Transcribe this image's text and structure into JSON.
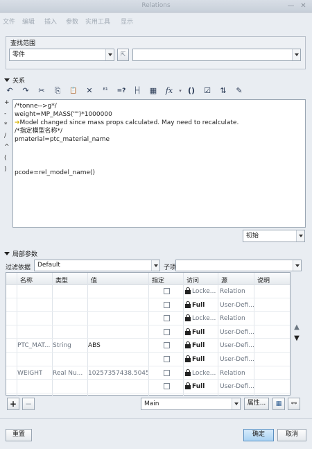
{
  "window": {
    "title": "Relations"
  },
  "menu": [
    "文件",
    "编辑",
    "插入",
    "参数",
    "实用工具",
    "显示"
  ],
  "lookup": {
    "header": "查找范围",
    "scope_value": "零件",
    "object_value": ""
  },
  "relations": {
    "header": "关系",
    "toolbar_icons": [
      "undo-icon",
      "redo-icon",
      "cut-icon",
      "copy-icon",
      "paste-icon",
      "delete-icon",
      "evaluate-icon",
      "equals-icon",
      "measure-icon",
      "units-icon",
      "function-icon",
      "parentheses-icon",
      "verify-icon",
      "sort-icon",
      "insert-icon"
    ],
    "toolbar_glyphs": [
      "↶",
      "↷",
      "✂",
      "⎘",
      "📋",
      "✕",
      "⁸¹",
      "=?",
      "├┤",
      "▦",
      "fx",
      "()",
      "☑",
      "⇅",
      "✎"
    ],
    "side_symbols": [
      "+",
      "-",
      "*",
      "/",
      "^",
      "(",
      ")"
    ],
    "lines": [
      "/*tonne-->g*/",
      "weight=MP_MASS(\"\")*1000000",
      "Model changed since mass props calculated. May need to recalculate.",
      "/*指定模型名称*/",
      "pmaterial=ptc_material_name",
      "",
      "",
      "",
      "pcode=rel_model_name()"
    ],
    "init_select": "初始"
  },
  "local_params": {
    "header": "局部参数",
    "filter_label": "过滤依据",
    "filter_value": "Default",
    "subitem_label": "子项",
    "subitem_value": "",
    "columns": [
      "名称",
      "类型",
      "值",
      "指定",
      "访问",
      "源",
      "说明"
    ],
    "rows": [
      {
        "name": "",
        "type": "",
        "value": "",
        "access": "Locke...",
        "source": "Relation"
      },
      {
        "name": "",
        "type": "",
        "value": "",
        "access": "Full",
        "source": "User-Defi..."
      },
      {
        "name": "",
        "type": "",
        "value": "",
        "access": "Locke...",
        "source": "Relation"
      },
      {
        "name": "",
        "type": "",
        "value": "",
        "access": "Full",
        "source": "User-Defi..."
      },
      {
        "name": "PTC_MAT...",
        "type": "String",
        "value": "ABS",
        "access": "Full",
        "source": "User-Defi..."
      },
      {
        "name": "",
        "type": "",
        "value": "",
        "access": "Full",
        "source": "User-Defi..."
      },
      {
        "name": "WEIGHT",
        "type": "Real Nu...",
        "value": "10257357438.5045...",
        "access": "Locke...",
        "source": "Relation"
      },
      {
        "name": "",
        "type": "",
        "value": "",
        "access": "Full",
        "source": "User-Defi..."
      }
    ],
    "add_label": "+",
    "remove_label": "−",
    "main_select": "Main",
    "props_button": "属性...",
    "up_arrow": "▲",
    "down_arrow": "▼"
  },
  "footer": {
    "reset": "重置",
    "ok": "确定",
    "cancel": "取消"
  }
}
